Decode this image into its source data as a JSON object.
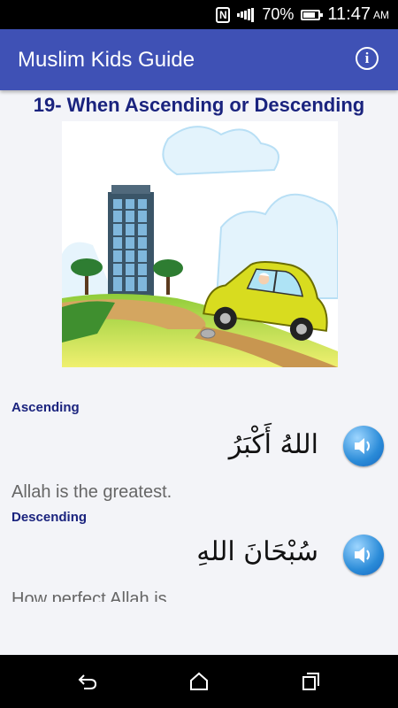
{
  "status_bar": {
    "nfc": "N",
    "battery_percent": "70%",
    "time": "11:47",
    "ampm": "AM"
  },
  "app_bar": {
    "title": "Muslim Kids Guide",
    "info_icon": "info-icon"
  },
  "lesson": {
    "title": "19- When Ascending or Descending",
    "illustration": "car-climbing-hill-illustration",
    "sections": [
      {
        "label": "Ascending",
        "arabic": "اللهُ أَكْبَرُ",
        "translation": "Allah is the greatest."
      },
      {
        "label": "Descending",
        "arabic": "سُبْحَانَ اللهِ",
        "translation": "How perfect Allah is."
      }
    ]
  },
  "nav_bar": {
    "back_icon": "back-icon",
    "home_icon": "home-icon",
    "recents_icon": "recents-icon"
  },
  "colors": {
    "app_bar": "#3f51b5",
    "title_text": "#1a237e",
    "background": "#f3f4f8"
  }
}
